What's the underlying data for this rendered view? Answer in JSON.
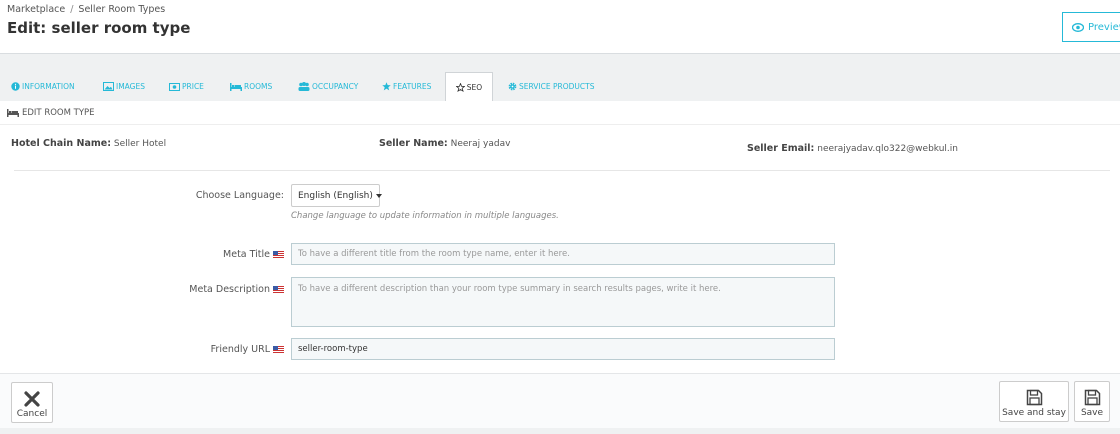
{
  "breadcrumb": {
    "items": [
      "Marketplace",
      "Seller Room Types"
    ],
    "separator": "/"
  },
  "page": {
    "title": "Edit: seller room type",
    "preview_label": "Preview"
  },
  "tabs": [
    {
      "label": "Information",
      "icon": "info-circle-icon"
    },
    {
      "label": "Images",
      "icon": "image-icon"
    },
    {
      "label": "Price",
      "icon": "money-icon"
    },
    {
      "label": "Rooms",
      "icon": "bed-icon"
    },
    {
      "label": "Occupancy",
      "icon": "users-icon"
    },
    {
      "label": "Features",
      "icon": "star-icon"
    },
    {
      "label": "SEO",
      "icon": "star-outline-icon",
      "active": true
    },
    {
      "label": "Service Products",
      "icon": "cog-icon"
    }
  ],
  "panel": {
    "heading": "Edit Room Type",
    "hotel_chain": {
      "label": "Hotel Chain Name:",
      "value": "Seller Hotel"
    },
    "seller_name": {
      "label": "Seller Name:",
      "value": "Neeraj yadav"
    },
    "seller_email": {
      "label": "Seller Email:",
      "value": "neerajyadav.qlo322@webkul.in"
    }
  },
  "form": {
    "language": {
      "label": "Choose Language:",
      "value": "English (English)",
      "help": "Change language to update information in multiple languages."
    },
    "meta_title": {
      "label": "Meta Title",
      "value": "",
      "placeholder": "To have a different title from the room type name, enter it here."
    },
    "meta_description": {
      "label": "Meta Description",
      "value": "",
      "placeholder": "To have a different description than your room type summary in search results pages, write it here."
    },
    "friendly_url": {
      "label": "Friendly URL",
      "value": "seller-room-type"
    }
  },
  "footer": {
    "cancel_label": "Cancel",
    "save_stay_label": "Save and stay",
    "save_label": "Save"
  },
  "colors": {
    "accent": "#25b9d7",
    "background": "#eff1f2",
    "input_bg": "#f5f8f9"
  }
}
